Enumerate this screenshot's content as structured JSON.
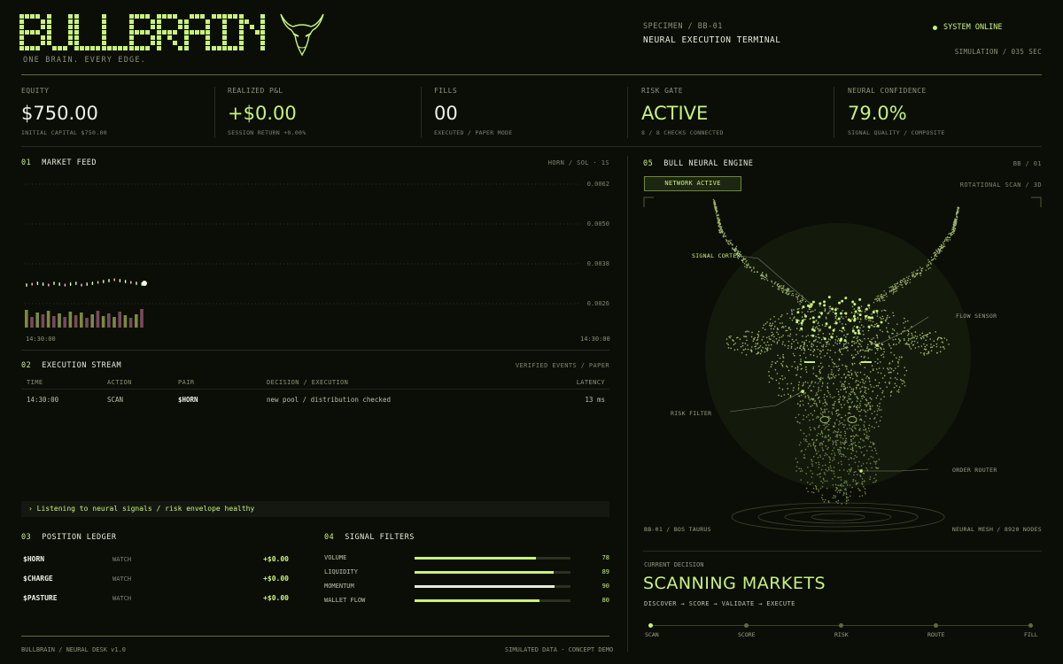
{
  "brand": {
    "name": "BULLBRAIN",
    "tagline": "ONE BRAIN. EVERY EDGE."
  },
  "header": {
    "specimen": "SPECIMEN / BB-01",
    "title": "NEURAL EXECUTION TERMINAL",
    "status": "SYSTEM ONLINE",
    "simulation": "SIMULATION / 035 SEC"
  },
  "kpis": [
    {
      "label": "EQUITY",
      "value": "$750.00",
      "sub": "INITIAL CAPITAL  $750.00"
    },
    {
      "label": "REALIZED P&L",
      "value": "+$0.00",
      "sub": "SESSION RETURN  +0.00%"
    },
    {
      "label": "FILLS",
      "value": "00",
      "sub": "EXECUTED / PAPER MODE"
    },
    {
      "label": "RISK GATE",
      "value": "ACTIVE",
      "sub": "8 / 8 CHECKS CONNECTED"
    },
    {
      "label": "NEURAL CONFIDENCE",
      "value": "79.0%",
      "sub": "SIGNAL QUALITY / COMPOSITE"
    }
  ],
  "market_feed": {
    "num": "01",
    "title": "MARKET FEED",
    "pair_info": "HORN / SOL  ·  1S",
    "y_ticks": [
      "0.0062",
      "0.0050",
      "0.0038",
      "0.0026"
    ],
    "time_start": "14:30:00",
    "time_end": "14:30:00"
  },
  "execution_stream": {
    "num": "02",
    "title": "EXECUTION STREAM",
    "right": "VERIFIED EVENTS / PAPER",
    "columns": [
      "TIME",
      "ACTION",
      "PAIR",
      "DECISION / EXECUTION",
      "LATENCY"
    ],
    "rows": [
      {
        "time": "14:30:00",
        "action": "SCAN",
        "pair": "$HORN",
        "decision": "new pool / distribution checked",
        "latency": "13 ms"
      }
    ],
    "status": "› Listening to neural signals / risk envelope healthy"
  },
  "ledger": {
    "num": "03",
    "title": "POSITION LEDGER",
    "rows": [
      {
        "symbol": "$HORN",
        "state": "WATCH",
        "pnl": "+$0.00"
      },
      {
        "symbol": "$CHARGE",
        "state": "WATCH",
        "pnl": "+$0.00"
      },
      {
        "symbol": "$PASTURE",
        "state": "WATCH",
        "pnl": "+$0.00"
      }
    ]
  },
  "filters": {
    "num": "04",
    "title": "SIGNAL FILTERS",
    "rows": [
      {
        "name": "VOLUME",
        "value": 78
      },
      {
        "name": "LIQUIDITY",
        "value": 89
      },
      {
        "name": "MOMENTUM",
        "value": 90
      },
      {
        "name": "WALLET FLOW",
        "value": 80
      }
    ]
  },
  "footer": {
    "left": "BULLBRAIN / NEURAL DESK v1.0",
    "right": "SIMULATED DATA · CONCEPT DEMO"
  },
  "engine": {
    "num": "05",
    "title": "BULL NEURAL ENGINE",
    "right": "BB / 01",
    "badge": "NETWORK ACTIVE",
    "scan": "ROTATIONAL SCAN / 3D",
    "callouts": {
      "signal_cortex": "SIGNAL CORTEX",
      "flow_sensor": "FLOW SENSOR",
      "risk_filter": "RISK FILTER",
      "order_router": "ORDER ROUTER"
    },
    "specimen": "BB-01 / BOS TAURUS",
    "mesh": "NEURAL MESH  /  8920 NODES"
  },
  "decision": {
    "label": "CURRENT DECISION",
    "value": "SCANNING MARKETS",
    "steps": "DISCOVER → SCORE → VALIDATE → EXECUTE",
    "pipeline": [
      "SCAN",
      "SCORE",
      "RISK",
      "ROUTE",
      "FILL"
    ]
  },
  "colors": {
    "accent": "#c8f27a",
    "background": "#0b0e07",
    "volume_up": "#7d8a3c",
    "volume_down": "#7a4a5c"
  }
}
